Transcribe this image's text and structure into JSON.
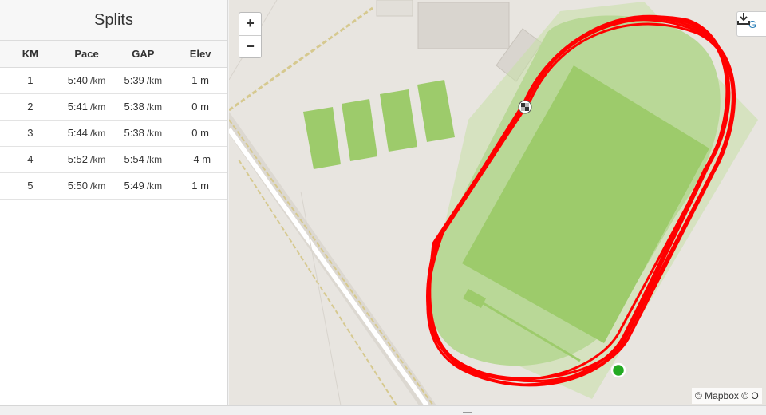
{
  "splits": {
    "title": "Splits",
    "headers": {
      "km": "KM",
      "pace": "Pace",
      "gap": "GAP",
      "elev": "Elev"
    },
    "rows": [
      {
        "km": "1",
        "pace": "5:40",
        "pace_unit": "/km",
        "gap": "5:39",
        "gap_unit": "/km",
        "elev": "1 m"
      },
      {
        "km": "2",
        "pace": "5:41",
        "pace_unit": "/km",
        "gap": "5:38",
        "gap_unit": "/km",
        "elev": "0 m"
      },
      {
        "km": "3",
        "pace": "5:44",
        "pace_unit": "/km",
        "gap": "5:38",
        "gap_unit": "/km",
        "elev": "0 m"
      },
      {
        "km": "4",
        "pace": "5:52",
        "pace_unit": "/km",
        "gap": "5:54",
        "gap_unit": "/km",
        "elev": "-4 m"
      },
      {
        "km": "5",
        "pace": "5:50",
        "pace_unit": "/km",
        "gap": "5:49",
        "gap_unit": "/km",
        "elev": "1 m"
      }
    ]
  },
  "map": {
    "zoom_in_label": "+",
    "zoom_out_label": "−",
    "download_label": "G",
    "attribution": "© Mapbox © O",
    "colors": {
      "route": "#ff0000",
      "field": "#9dcb6b",
      "start_marker": "#22aa22",
      "land": "#e8e5e0"
    },
    "icons": [
      "download-icon",
      "start-marker-icon",
      "finish-flag-icon"
    ]
  }
}
